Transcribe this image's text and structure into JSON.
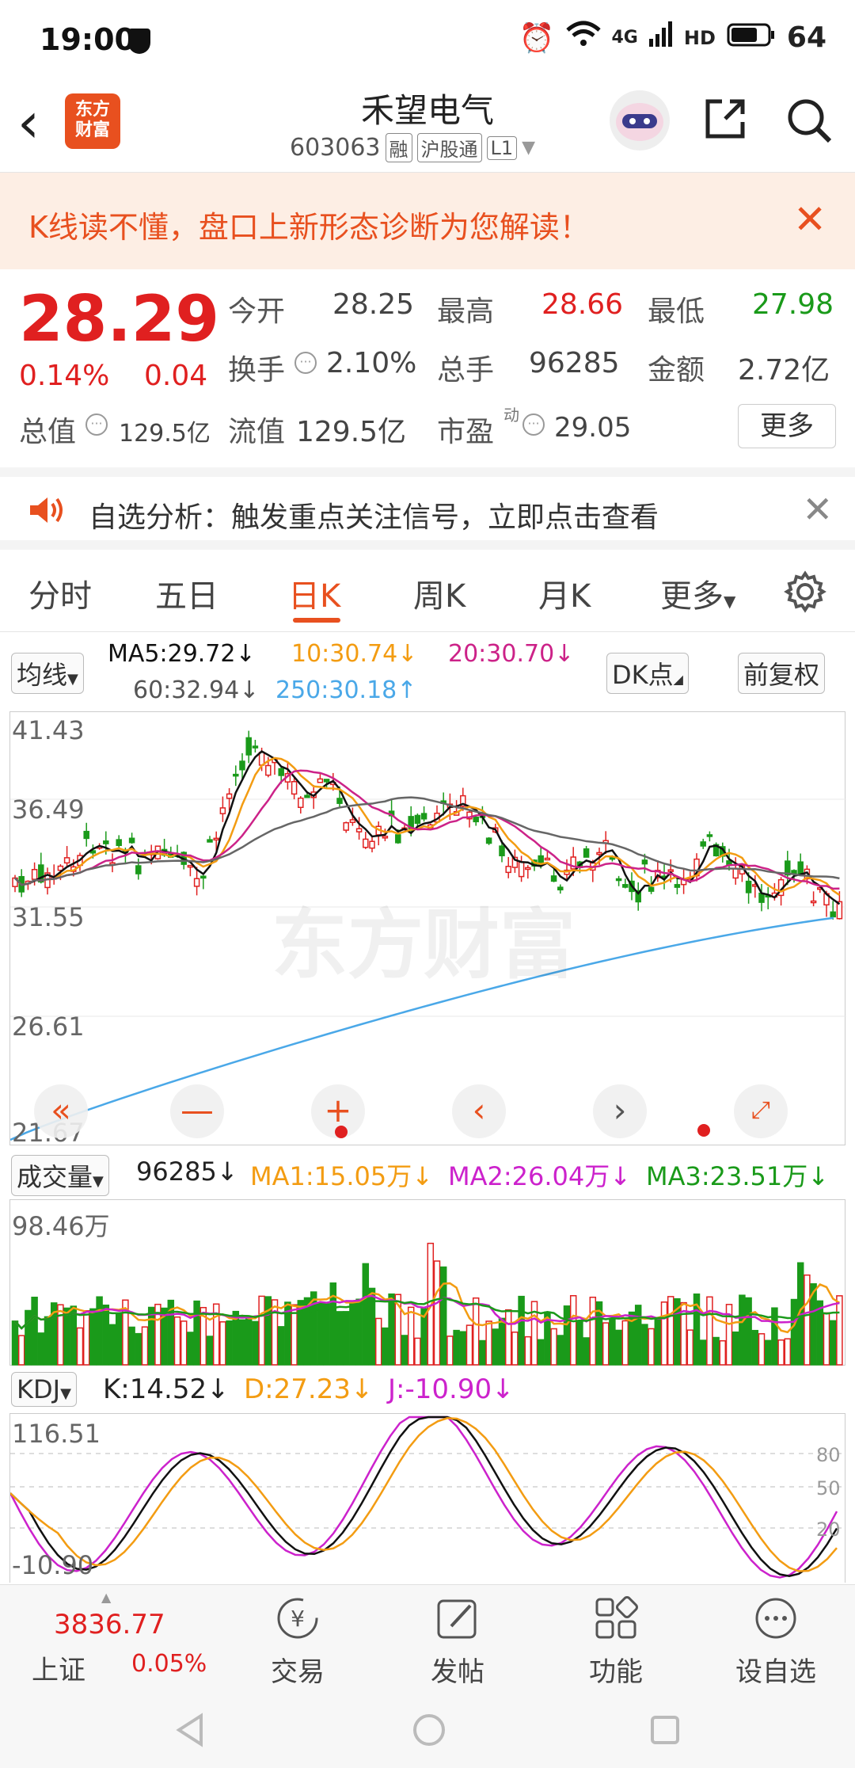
{
  "status": {
    "time": "19:00",
    "battery": "64",
    "network": "4G",
    "hd": "HD"
  },
  "header": {
    "title": "禾望电气",
    "code": "603063",
    "tags": [
      "融",
      "沪股通",
      "L1"
    ],
    "logo": "东方\n财富"
  },
  "banner": {
    "text": "K线读不懂，盘口上新形态诊断为您解读！"
  },
  "quote": {
    "price": "28.29",
    "change_pct": "0.14%",
    "change": "0.04",
    "open_label": "今开",
    "open": "28.25",
    "high_label": "最高",
    "high": "28.66",
    "low_label": "最低",
    "low": "27.98",
    "turnover_label": "换手",
    "turnover": "2.10%",
    "vol_label": "总手",
    "vol": "96285",
    "amount_label": "金额",
    "amount": "2.72亿",
    "mktcap_label": "总值",
    "mktcap": "129.5亿",
    "float_label": "流值",
    "float": "129.5亿",
    "pe_label": "市盈",
    "pe_sup": "动",
    "pe": "29.05",
    "more": "更多"
  },
  "notice": {
    "text": "自选分析：触发重点关注信号，立即点击查看"
  },
  "tabs": [
    "分时",
    "五日",
    "日K",
    "周K",
    "月K",
    "更多"
  ],
  "active_tab": "日K",
  "ma": {
    "selector": "均线",
    "ma5": "MA5:29.72↓",
    "ma10": "10:30.74↓",
    "ma20": "20:30.70↓",
    "ma60": "60:32.94↓",
    "ma250": "250:30.18↑",
    "dk": "DK点",
    "fuquan": "前复权"
  },
  "price_axis": [
    "41.43",
    "36.49",
    "31.55",
    "26.61",
    "21.67"
  ],
  "watermark": "东方财富",
  "volume": {
    "selector": "成交量",
    "value": "96285↓",
    "ma1": "MA1:15.05万↓",
    "ma2": "MA2:26.04万↓",
    "ma3": "MA3:23.51万↓",
    "axis_top": "98.46万"
  },
  "kdj": {
    "selector": "KDJ",
    "k": "K:14.52↓",
    "d": "D:27.23↓",
    "j": "J:-10.90↓",
    "axis_top": "116.51",
    "axis_bottom": "-10.90",
    "levels": [
      "80",
      "50",
      "20"
    ]
  },
  "bottom": {
    "index_value": "3836.77",
    "index_name": "上证",
    "index_pct": "0.05%",
    "items": [
      "交易",
      "发帖",
      "功能",
      "设自选"
    ]
  },
  "colors": {
    "up": "#e02020",
    "down": "#1a9a1a",
    "accent": "#e8501f",
    "ma5": "#111111",
    "ma10": "#f39c12",
    "ma20": "#cc2288",
    "ma60": "#666666",
    "ma250": "#4aa8e8"
  }
}
